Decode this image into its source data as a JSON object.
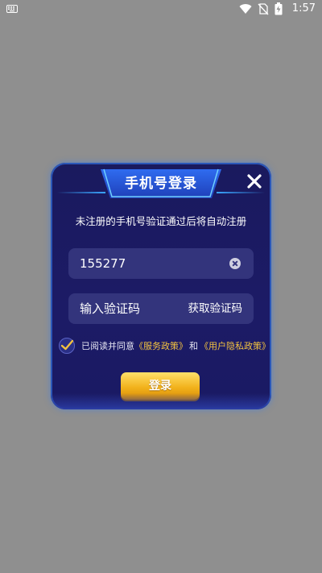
{
  "status_bar": {
    "time": "1:57",
    "icons": [
      "keyboard-icon",
      "wifi-icon",
      "no-sim-icon",
      "battery-charging-icon"
    ]
  },
  "dialog": {
    "title": "手机号登录",
    "subtitle": "未注册的手机号验证通过后将自动注册",
    "phone_value": "155277",
    "code_placeholder": "输入验证码",
    "get_code_label": "获取验证码",
    "agree_prefix": "已阅读并同意",
    "service_policy": "《服务政策》",
    "agree_and": "和",
    "privacy_policy": "《用户隐私政策》",
    "login_label": "登录",
    "agree_checked": true
  },
  "colors": {
    "background": "#8f8f8f",
    "dialog": "#1c1b66",
    "field": "#33347c",
    "accent_gold": "#f3c240",
    "border_blue": "#2b57b8"
  }
}
